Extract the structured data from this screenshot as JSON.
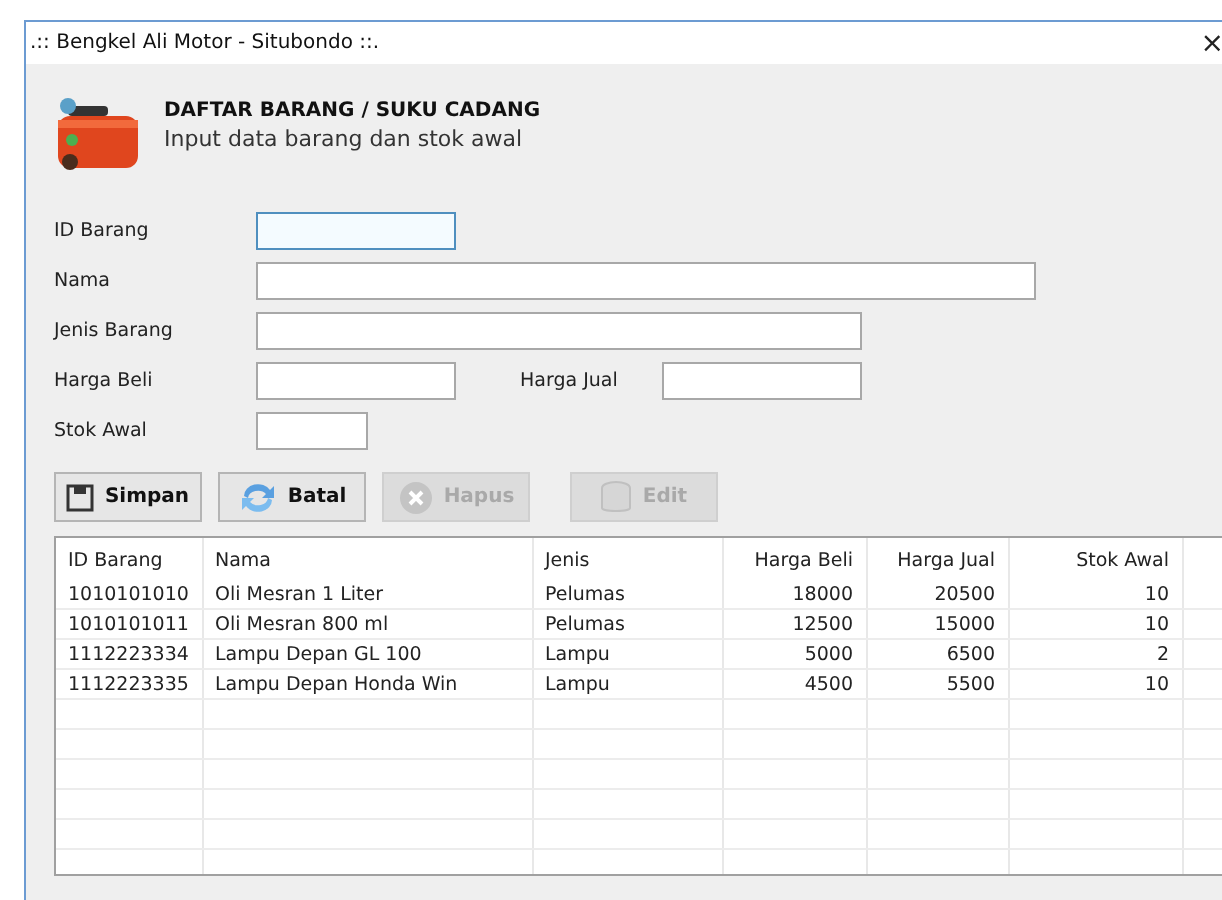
{
  "window": {
    "title": ".:: Bengkel Ali Motor - Situbondo ::.",
    "close": "×"
  },
  "header": {
    "title": "DAFTAR BARANG / SUKU CADANG",
    "subtitle": "Input data barang dan stok awal"
  },
  "fields": [
    {
      "label": "ID Barang",
      "kind": "short",
      "focused": true
    },
    {
      "label": "Nama",
      "kind": "long",
      "focused": false
    },
    {
      "label": "Jenis Barang",
      "kind": "medium",
      "focused": false
    },
    {
      "label": "Harga Beli",
      "kind": "pair",
      "focused": false,
      "second_label": "Harga Jual"
    },
    {
      "label": "Stok Awal",
      "kind": "tiny",
      "focused": false
    }
  ],
  "buttons": [
    {
      "label": "Simpan",
      "kind": "save",
      "disabled": false
    },
    {
      "label": "Batal",
      "kind": "refresh",
      "disabled": false
    },
    {
      "label": "Hapus",
      "kind": "delete",
      "disabled": true
    },
    {
      "label": "Edit",
      "kind": "edit",
      "disabled": true
    }
  ],
  "table": {
    "columns": [
      "ID Barang",
      "Nama",
      "Jenis",
      "Harga Beli",
      "Harga Jual",
      "Stok Awal"
    ],
    "rows": [
      [
        "1010101010",
        "Oli Mesran 1 Liter",
        "Pelumas",
        "18000",
        "20500",
        "10"
      ],
      [
        "1010101011",
        "Oli Mesran 800 ml",
        "Pelumas",
        "12500",
        "15000",
        "10"
      ],
      [
        "1112223334",
        "Lampu Depan GL 100",
        "Lampu",
        "5000",
        "6500",
        "2"
      ],
      [
        "1112223335",
        "Lampu Depan Honda Win",
        "Lampu",
        "4500",
        "5500",
        "10"
      ]
    ]
  }
}
